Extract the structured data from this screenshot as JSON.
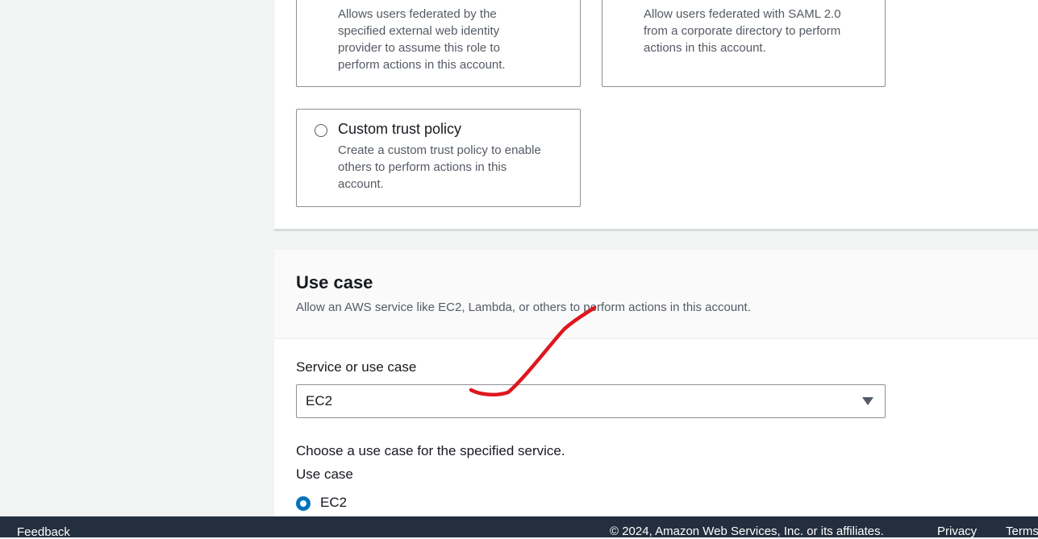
{
  "trust_tiles": {
    "web_identity": {
      "description_lines": [
        "Allows users federated by the",
        "specified external web identity",
        "provider to assume this role to",
        "perform actions in this account."
      ]
    },
    "saml": {
      "description_lines": [
        "Allow users federated with SAML 2.0",
        "from a corporate directory to perform",
        "actions in this account."
      ]
    },
    "custom": {
      "title": "Custom trust policy",
      "description_lines": [
        "Create a custom trust policy to enable",
        "others to perform actions in this",
        "account."
      ]
    }
  },
  "use_case_section": {
    "title": "Use case",
    "description": "Allow an AWS service like EC2, Lambda, or others to perform actions in this account.",
    "service_label": "Service or use case",
    "service_value": "EC2",
    "choose_prompt": "Choose a use case for the specified service.",
    "use_case_label": "Use case",
    "selected_option": "EC2"
  },
  "footer": {
    "feedback": "Feedback",
    "copyright": "© 2024, Amazon Web Services, Inc. or its affiliates.",
    "privacy": "Privacy",
    "terms": "Terms"
  },
  "colors": {
    "accent": "#0073bb",
    "footer_bg": "#232f3e",
    "annotation": "#e0161e"
  }
}
